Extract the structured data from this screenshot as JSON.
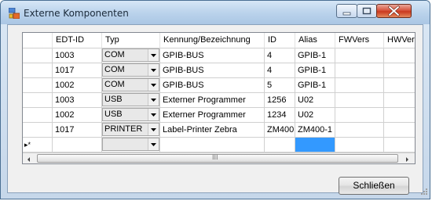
{
  "window": {
    "title": "Externe Komponenten"
  },
  "colors": {
    "selection": "#3399ff",
    "title_close": "#c9391f"
  },
  "icons": {
    "app": "form-icon",
    "minimize": "minimize-icon",
    "maximize": "maximize-icon",
    "close": "close-icon"
  },
  "grid": {
    "columns": [
      "EDT-ID",
      "Typ",
      "Kennung/Bezeichnung",
      "ID",
      "Alias",
      "FWVers",
      "HWVer"
    ],
    "rows": [
      {
        "edt_id": "1003",
        "typ": "COM",
        "kennung": "GPIB-BUS",
        "id": "4",
        "alias": "GPIB-1"
      },
      {
        "edt_id": "1017",
        "typ": "COM",
        "kennung": "GPIB-BUS",
        "id": "4",
        "alias": "GPIB-1"
      },
      {
        "edt_id": "1002",
        "typ": "COM",
        "kennung": "GPIB-BUS",
        "id": "5",
        "alias": "GPIB-1"
      },
      {
        "edt_id": "1003",
        "typ": "USB",
        "kennung": "Externer Programmer",
        "id": "1256",
        "alias": "U02"
      },
      {
        "edt_id": "1002",
        "typ": "USB",
        "kennung": "Externer Programmer",
        "id": "1234",
        "alias": "U02"
      },
      {
        "edt_id": "1017",
        "typ": "PRINTER",
        "kennung": "Label-Printer Zebra",
        "id": "ZM400",
        "alias": "ZM400-1"
      }
    ],
    "new_row_marker": "▸*",
    "scroll_thumb": "III"
  },
  "buttons": {
    "close_label": "Schließen"
  }
}
